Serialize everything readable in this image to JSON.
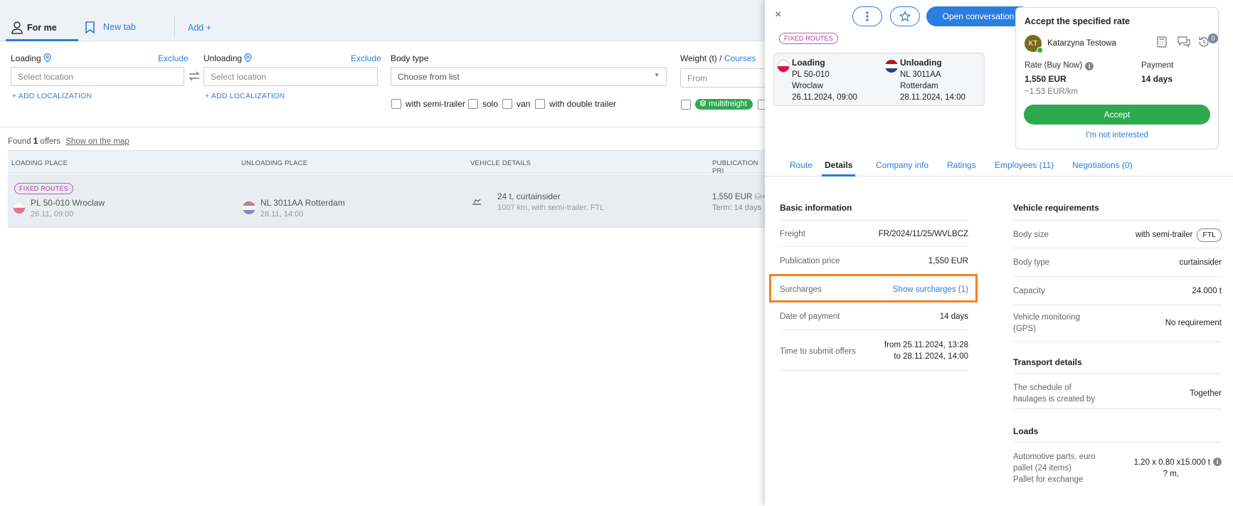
{
  "tabs": {
    "for_me": "For me",
    "new_tab": "New tab",
    "add": "Add +"
  },
  "filters": {
    "loading_label": "Loading",
    "unloading_label": "Unloading",
    "exclude": "Exclude",
    "select_location": "Select location",
    "add_localization": "+ ADD LOCALIZATION",
    "body_type_label": "Body type",
    "body_type_placeholder": "Choose from list",
    "weight_label": "Weight (t) /",
    "courses_link": "Courses",
    "from_placeholder": "From",
    "checkboxes": [
      "with semi-trailer",
      "solo",
      "van",
      "with double trailer"
    ],
    "multifreight": "multifreight"
  },
  "results": {
    "found_prefix": "Found",
    "found_count": "1",
    "found_suffix": "offers",
    "show_on_map": "Show on the map",
    "columns": [
      "LOADING PLACE",
      "UNLOADING PLACE",
      "VEHICLE DETAILS",
      "PUBLICATION PRI"
    ],
    "row": {
      "badge": "FIXED ROUTES",
      "loading_place": "PL 50-010 Wroclaw",
      "loading_date": "26.11, 09:00",
      "unloading_place": "NL 3011AA Rotterdam",
      "unloading_date": "28.11, 14:00",
      "vehicle_main": "24 t, curtainsider",
      "vehicle_sub": "1007 km, with semi-trailer, FTL",
      "price": "1,550 EUR",
      "term": "Term: 14 days"
    }
  },
  "panel": {
    "close": "×",
    "open_conversation": "Open conversation",
    "badge": "FIXED ROUTES",
    "route": {
      "loading_title": "Loading",
      "loading_postal": "PL 50-010",
      "loading_city": "Wroclaw",
      "loading_date": "26.11.2024, 09:00",
      "unloading_title": "Unloading",
      "unloading_postal": "NL 3011AA",
      "unloading_city": "Rotterdam",
      "unloading_date": "28.11.2024, 14:00"
    },
    "rate": {
      "title": "Accept the specified rate",
      "avatar_initials": "KT",
      "user_name": "Katarzyna Testowa",
      "notif_count": "0",
      "rate_label": "Rate (Buy Now)",
      "rate_value": "1,550 EUR",
      "rate_per_km": "~1.53 EUR/km",
      "payment_label": "Payment",
      "payment_value": "14 days",
      "accept": "Accept",
      "not_interested": "I'm not interested"
    },
    "tabs": [
      "Route",
      "Details",
      "Company info",
      "Ratings",
      "Employees (11)",
      "Negotiations (0)"
    ],
    "basic": {
      "title": "Basic information",
      "freight_label": "Freight",
      "freight_value": "FR/2024/11/25/WVLBCZ",
      "pub_price_label": "Publication price",
      "pub_price_value": "1,550 EUR",
      "surcharges_label": "Surcharges",
      "surcharges_value": "Show surcharges (1)",
      "date_payment_label": "Date of payment",
      "date_payment_value": "14 days",
      "time_submit_label": "Time to submit offers",
      "time_submit_from": "from 25.11.2024, 13:28",
      "time_submit_to": "to 28.11.2024, 14:00"
    },
    "vehicle": {
      "title": "Vehicle requirements",
      "body_size_label": "Body size",
      "body_size_value": "with semi-trailer",
      "body_size_badge": "FTL",
      "body_type_label": "Body type",
      "body_type_value": "curtainsider",
      "capacity_label": "Capacity",
      "capacity_value": "24.000 t",
      "monitoring_label_1": "Vehicle monitoring",
      "monitoring_label_2": "(GPS)",
      "monitoring_value": "No requirement"
    },
    "transport": {
      "title": "Transport details",
      "schedule_label_1": "The schedule of",
      "schedule_label_2": "haulages is created by",
      "schedule_value": "Together"
    },
    "loads": {
      "title": "Loads",
      "item_line_1": "Automotive parts, euro",
      "item_line_2": "pallet (24 items)",
      "item_line_3": "Pallet for exchange",
      "dims_1": "1.20 x 0.80 x15.000 t",
      "dims_2": "? m,"
    }
  },
  "colors": {
    "accent": "#2b7de0",
    "green": "#2daa4f",
    "highlight": "#f5821f",
    "badge_purple": "#c455c8"
  }
}
